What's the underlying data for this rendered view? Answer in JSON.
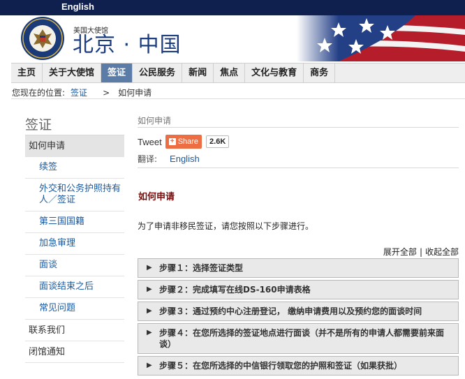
{
  "topbar": {
    "lang_link": "English"
  },
  "header": {
    "embassy_small": "美国大使馆",
    "embassy_big": "北京 · 中国"
  },
  "nav": {
    "items": [
      {
        "label": "主页"
      },
      {
        "label": "关于大使馆"
      },
      {
        "label": "签证",
        "active": true
      },
      {
        "label": "公民服务"
      },
      {
        "label": "新闻"
      },
      {
        "label": "焦点"
      },
      {
        "label": "文化与教育"
      },
      {
        "label": "商务"
      }
    ]
  },
  "breadcrumb": {
    "prefix": "您现在的位置:",
    "items": [
      "签证",
      "如何申请"
    ],
    "separator": ">"
  },
  "sidebar": {
    "title": "签证",
    "items": [
      {
        "label": "如何申请",
        "level": "main",
        "active": true
      },
      {
        "label": "续签",
        "level": "sub"
      },
      {
        "label": "外交和公务护照持有人／签证",
        "level": "sub"
      },
      {
        "label": "第三国国籍",
        "level": "sub"
      },
      {
        "label": "加急审理",
        "level": "sub"
      },
      {
        "label": "面谈",
        "level": "sub"
      },
      {
        "label": "面谈结束之后",
        "level": "sub"
      },
      {
        "label": "常见问题",
        "level": "sub"
      },
      {
        "label": "联系我们",
        "level": "main"
      },
      {
        "label": "闭馆通知",
        "level": "main"
      }
    ]
  },
  "content": {
    "title": "如何申请",
    "share": {
      "tweet": "Tweet",
      "share_label": "Share",
      "share_count": "2.6K"
    },
    "translate": {
      "label": "翻译:",
      "link": "English"
    },
    "section_title": "如何申请",
    "intro": "为了申请非移民签证，请您按照以下步骤进行。",
    "expand_all": "展开全部",
    "collapse_all": "收起全部",
    "steps": [
      "步骤１：选择签证类型",
      "步骤２：完成填写在线DS-160申请表格",
      "步骤３：通过预约中心注册登记，  缴纳申请费用以及预约您的面谈时间",
      "步骤４：在您所选择的签证地点进行面谈（并不是所有的申请人都需要前来面谈）",
      "步骤５：在您所选择的中信银行领取您的护照和签证（如果获批）"
    ]
  },
  "colors": {
    "topbar": "#10204e",
    "nav_active": "#5c7ca8",
    "link": "#1b5aa0",
    "section_title": "#7a0b0b",
    "share_button": "#ee6e44"
  },
  "icons": [
    "embassy-seal-icon",
    "us-flag-icon",
    "share-plus-icon",
    "triangle-right-icon"
  ]
}
